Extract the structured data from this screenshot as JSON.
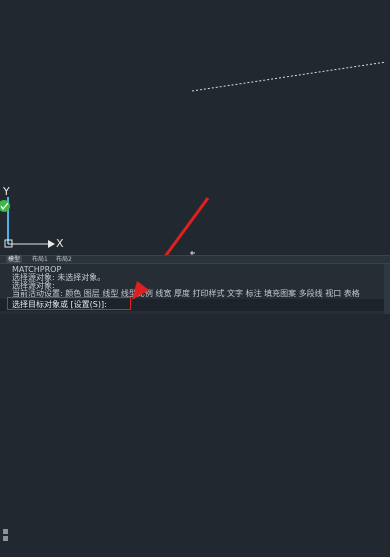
{
  "colors": {
    "background": "#212830",
    "ucs_y_bar": "#4fb3e6",
    "ucs_badge": "#3fb84b",
    "annotation_red": "#e02020"
  },
  "ucs": {
    "x_label": "X",
    "y_label": "Y"
  },
  "layout_tabs": [
    "模型",
    "布局1",
    "布局2"
  ],
  "layout_tabs_active": 0,
  "command_history": [
    "MATCHPROP",
    "选择源对象: 未选择对象。",
    "选择源对象:",
    "当前活动设置: 颜色 图层 线型 线型比例 线宽 厚度 打印样式 文字 标注 填充图案 多段线 视口 表格"
  ],
  "command_prompt": "选择目标对象或 [设置(S)]:",
  "icons": [
    "arrow-annotation",
    "ucs-icon",
    "crosshair-marker"
  ]
}
